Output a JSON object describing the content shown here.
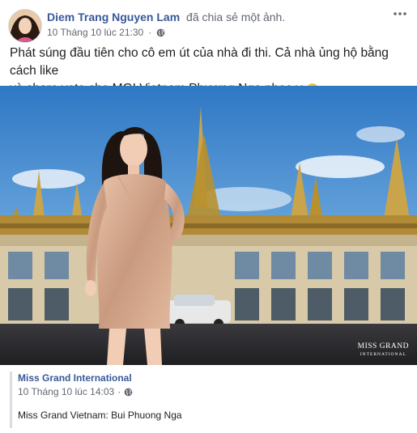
{
  "post": {
    "author_name": "Diem Trang Nguyen Lam",
    "author_action": "đã chia sẻ một ảnh.",
    "timestamp": "10 Tháng 10 lúc 21:30",
    "separator": "·",
    "privacy_icon": "globe-icon",
    "more_icon": "more-horizontal-icon",
    "text_line1": "Phát súng đầu tiên cho cô em út của nhà đi thi. Cả nhà ủng hộ bằng cách like",
    "text_line2": "và share vote cho MGI Vietnam Phương Nga nhoa",
    "emoji": [
      "heart-icon",
      "kissing-face-icon"
    ]
  },
  "photo": {
    "watermark_main": "MISS GRAND",
    "watermark_sub": "INTERNATIONAL"
  },
  "shared": {
    "page_name": "Miss Grand International",
    "timestamp": "10 Tháng 10 lúc 14:03",
    "separator": "·",
    "privacy_icon": "globe-icon",
    "text": "Miss Grand Vietnam: Bui Phuong Nga"
  },
  "colors": {
    "link": "#385898",
    "meta": "#616770",
    "sky": "#4a90d9",
    "gold": "#c9a44a"
  }
}
